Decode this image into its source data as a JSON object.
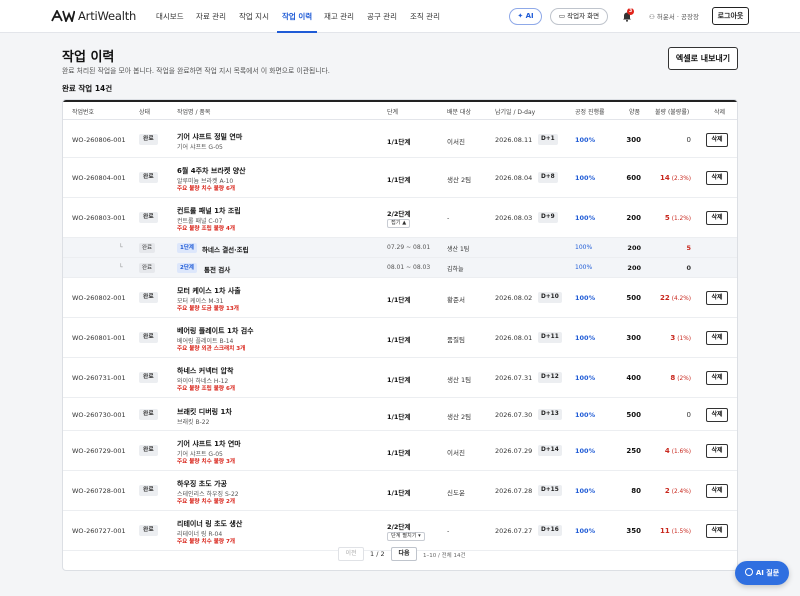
{
  "app": {
    "logo_text": "ArtiWealth"
  },
  "nav": [
    {
      "label": "대시보드",
      "active": false
    },
    {
      "label": "자료 관리",
      "active": false
    },
    {
      "label": "작업 지시",
      "active": false
    },
    {
      "label": "작업 이력",
      "active": true
    },
    {
      "label": "재고 관리",
      "active": false
    },
    {
      "label": "공구 관리",
      "active": false
    },
    {
      "label": "조직 관리",
      "active": false
    }
  ],
  "topbar": {
    "ai_label": "AI",
    "worker_label": "작업자 화면",
    "notification_count": "3",
    "user_label": "허윤서 · 공장장",
    "logout_label": "로그아웃"
  },
  "header": {
    "title": "작업 이력",
    "subtitle": "완료 처리된 작업을 모아 봅니다. 작업을 완료하면 작업 지시 목록에서 이 화면으로 이관됩니다.",
    "export_label": "엑셀로 내보내기",
    "count_label": "완료 작업 14건"
  },
  "table": {
    "headers": [
      "작업번호",
      "상태",
      "작업명 / 품목",
      "단계",
      "배분 대상",
      "납기일 / D-day",
      "공정 진행률",
      "양품",
      "불량 (불량률)",
      "삭제"
    ],
    "delete_label": "삭제",
    "rows": [
      {
        "wo": "WO-260806-001",
        "status": "완료",
        "name": "기어 샤프트 정밀 연마",
        "model": "기어 샤프트 G-05",
        "note": "",
        "stage": "1/1단계",
        "assignee": "이서진",
        "due": "2026.08.11",
        "dday": "D+1",
        "progress": "100%",
        "good": "300",
        "defect": "0",
        "defect_pct": ""
      },
      {
        "wo": "WO-260804-001",
        "status": "완료",
        "name": "6월 4주차 브라켓 양산",
        "model": "알루미늄 브라켓 A-10",
        "note": "주요 불량 치수 불량 6개",
        "stage": "1/1단계",
        "assignee": "생산 2팀",
        "due": "2026.08.04",
        "dday": "D+8",
        "progress": "100%",
        "good": "600",
        "defect": "14",
        "defect_pct": "(2.3%)"
      },
      {
        "wo": "WO-260803-001",
        "status": "완료",
        "name": "컨트롤 패널 1차 조립",
        "model": "컨트롤 패널 C-07",
        "note": "주요 불량 조립 불량 4개",
        "stage": "2/2단계",
        "fold": "접기 ▲",
        "assignee": "-",
        "due": "2026.08.03",
        "dday": "D+9",
        "progress": "100%",
        "good": "200",
        "defect": "5",
        "defect_pct": "(1.2%)"
      },
      {
        "wo": "WO-260802-001",
        "status": "완료",
        "name": "모터 케이스 1차 사출",
        "model": "모터 케이스 M-31",
        "note": "주요 불량 도금 불량 13개",
        "stage": "1/1단계",
        "assignee": "황준서",
        "due": "2026.08.02",
        "dday": "D+10",
        "progress": "100%",
        "good": "500",
        "defect": "22",
        "defect_pct": "(4.2%)"
      },
      {
        "wo": "WO-260801-001",
        "status": "완료",
        "name": "베어링 플레이트 1차 검수",
        "model": "베어링 플레이트 B-14",
        "note": "주요 불량 외관 스크래치 3개",
        "stage": "1/1단계",
        "assignee": "품질팀",
        "due": "2026.08.01",
        "dday": "D+11",
        "progress": "100%",
        "good": "300",
        "defect": "3",
        "defect_pct": "(1%)"
      },
      {
        "wo": "WO-260731-001",
        "status": "완료",
        "name": "하네스 커넥터 압착",
        "model": "와이어 하네스 H-12",
        "note": "주요 불량 조립 불량 6개",
        "stage": "1/1단계",
        "assignee": "생산 1팀",
        "due": "2026.07.31",
        "dday": "D+12",
        "progress": "100%",
        "good": "400",
        "defect": "8",
        "defect_pct": "(2%)"
      },
      {
        "wo": "WO-260730-001",
        "status": "완료",
        "name": "브래킷 디버링 1차",
        "model": "브래킷 B-22",
        "note": "",
        "stage": "1/1단계",
        "assignee": "생산 2팀",
        "due": "2026.07.30",
        "dday": "D+13",
        "progress": "100%",
        "good": "500",
        "defect": "0",
        "defect_pct": ""
      },
      {
        "wo": "WO-260729-001",
        "status": "완료",
        "name": "기어 샤프트 1차 연마",
        "model": "기어 샤프트 G-05",
        "note": "주요 불량 치수 불량 3개",
        "stage": "1/1단계",
        "assignee": "이서진",
        "due": "2026.07.29",
        "dday": "D+14",
        "progress": "100%",
        "good": "250",
        "defect": "4",
        "defect_pct": "(1.6%)"
      },
      {
        "wo": "WO-260728-001",
        "status": "완료",
        "name": "하우징 초도 가공",
        "model": "스테인리스 하우징 S-22",
        "note": "주요 불량 치수 불량 2개",
        "stage": "1/1단계",
        "assignee": "신도윤",
        "due": "2026.07.28",
        "dday": "D+15",
        "progress": "100%",
        "good": "80",
        "defect": "2",
        "defect_pct": "(2.4%)"
      },
      {
        "wo": "WO-260727-001",
        "status": "완료",
        "name": "리테이너 링 초도 생산",
        "model": "리테이너 링 R-04",
        "note": "주요 불량 치수 불량 7개",
        "stage": "2/2단계",
        "fold": "단계 펼치기 ▾",
        "assignee": "-",
        "due": "2026.07.27",
        "dday": "D+16",
        "progress": "100%",
        "good": "350",
        "defect": "11",
        "defect_pct": "(1.5%)"
      }
    ],
    "sub_rows": [
      {
        "status": "완료",
        "step": "1단계",
        "name": "하네스 결선·조립",
        "period": "07.29 ~ 08.01",
        "assignee": "생산 1팀",
        "progress": "100%",
        "good": "200",
        "defect": "5"
      },
      {
        "status": "완료",
        "step": "2단계",
        "name": "통전 검사",
        "period": "08.01 ~ 08.03",
        "assignee": "김하늘",
        "progress": "100%",
        "good": "200",
        "defect": "0"
      }
    ]
  },
  "pagination": {
    "prev_label": "이전",
    "page_label": "1 / 2",
    "next_label": "다음",
    "range_label": "1–10 / 전체 14건"
  },
  "fab": {
    "label": "AI 질문"
  },
  "colors": {
    "accent": "#1f5bd6",
    "defect": "#c8261c",
    "fab": "#2f6fe0"
  }
}
